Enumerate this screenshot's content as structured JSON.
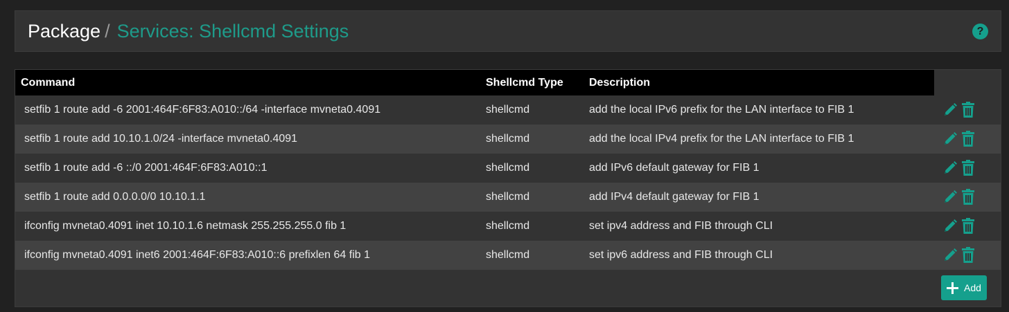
{
  "breadcrumb": {
    "root": "Package",
    "separator": "/",
    "current": "Services: Shellcmd Settings"
  },
  "help": {
    "icon": "question-circle-icon",
    "glyph": "?"
  },
  "table": {
    "headers": {
      "command": "Command",
      "type": "Shellcmd Type",
      "description": "Description"
    },
    "rows": [
      {
        "command": "setfib 1 route add -6 2001:464F:6F83:A010::/64 -interface mvneta0.4091",
        "type": "shellcmd",
        "description": "add the local IPv6 prefix for the LAN interface to FIB 1"
      },
      {
        "command": "setfib 1 route add 10.10.1.0/24 -interface mvneta0.4091",
        "type": "shellcmd",
        "description": "add the local IPv4 prefix for the LAN interface to FIB 1"
      },
      {
        "command": "setfib 1 route add -6 ::/0 2001:464F:6F83:A010::1",
        "type": "shellcmd",
        "description": "add IPv6 default gateway for FIB 1"
      },
      {
        "command": "setfib 1 route add 0.0.0.0/0 10.10.1.1",
        "type": "shellcmd",
        "description": "add IPv4 default gateway for FIB 1"
      },
      {
        "command": "ifconfig mvneta0.4091 inet 10.10.1.6 netmask 255.255.255.0 fib 1",
        "type": "shellcmd",
        "description": "set ipv4 address and FIB through CLI"
      },
      {
        "command": "ifconfig mvneta0.4091 inet6 2001:464F:6F83:A010::6 prefixlen 64 fib 1",
        "type": "shellcmd",
        "description": "set ipv6 address and FIB through CLI"
      }
    ]
  },
  "add_button": {
    "label": "Add",
    "icon": "plus-icon"
  },
  "colors": {
    "accent": "#15a08d",
    "title": "#1e9b8a",
    "header_bg": "#000000"
  }
}
